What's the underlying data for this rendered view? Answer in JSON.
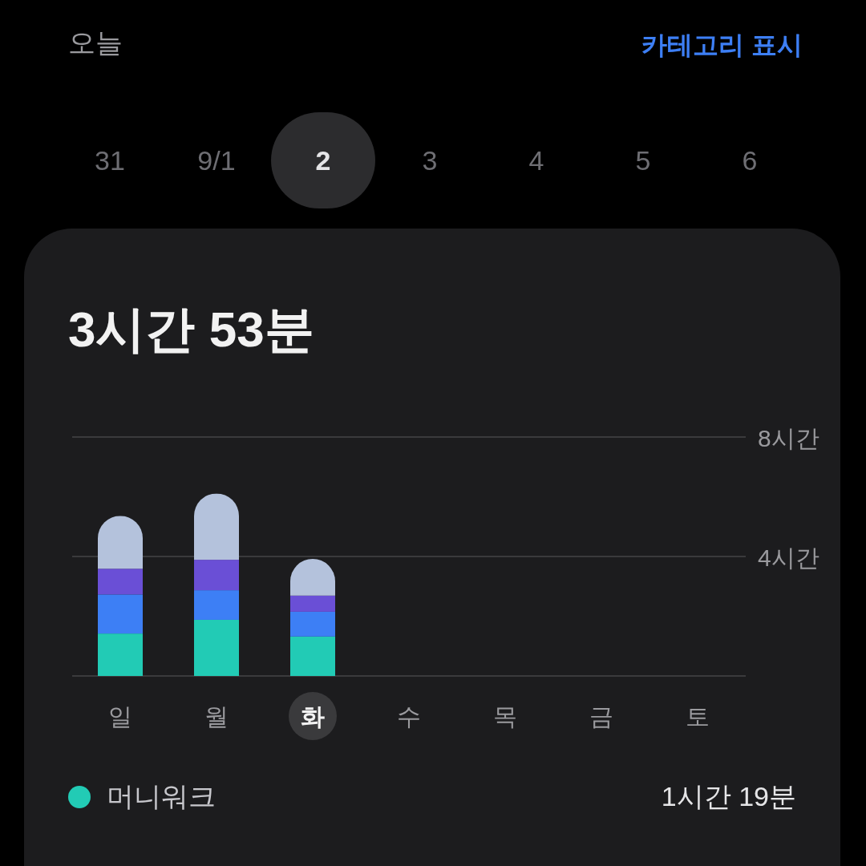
{
  "header": {
    "title": "오늘",
    "action": "카테고리 표시"
  },
  "dates": [
    {
      "label": "31",
      "selected": false
    },
    {
      "label": "9/1",
      "selected": false
    },
    {
      "label": "2",
      "selected": true
    },
    {
      "label": "3",
      "selected": false
    },
    {
      "label": "4",
      "selected": false
    },
    {
      "label": "5",
      "selected": false
    },
    {
      "label": "6",
      "selected": false
    }
  ],
  "summary": {
    "total": "3시간 53분",
    "chart_data": {
      "type": "bar",
      "stacked": true,
      "categories": [
        "일",
        "월",
        "화",
        "수",
        "목",
        "금",
        "토"
      ],
      "ylim": [
        0,
        8
      ],
      "yticks": [
        {
          "value": 4,
          "label": "4시간"
        },
        {
          "value": 8,
          "label": "8시간"
        }
      ],
      "series": [
        {
          "color": "#22cbb5",
          "values": [
            1.42,
            1.88,
            1.32,
            null,
            null,
            null,
            null
          ]
        },
        {
          "color": "#3d7ff5",
          "values": [
            1.31,
            0.99,
            0.83,
            null,
            null,
            null,
            null
          ]
        },
        {
          "color": "#6a4fd6",
          "values": [
            0.86,
            1.02,
            0.54,
            null,
            null,
            null,
            null
          ]
        },
        {
          "color": "#b4c2dc",
          "values": [
            1.77,
            2.22,
            1.23,
            null,
            null,
            null,
            null
          ]
        }
      ]
    },
    "category_selected": [
      false,
      false,
      true,
      false,
      false,
      false,
      false
    ],
    "legend": [
      {
        "label": "머니워크",
        "value": "1시간 19분",
        "color": "#22cbb5"
      }
    ]
  }
}
